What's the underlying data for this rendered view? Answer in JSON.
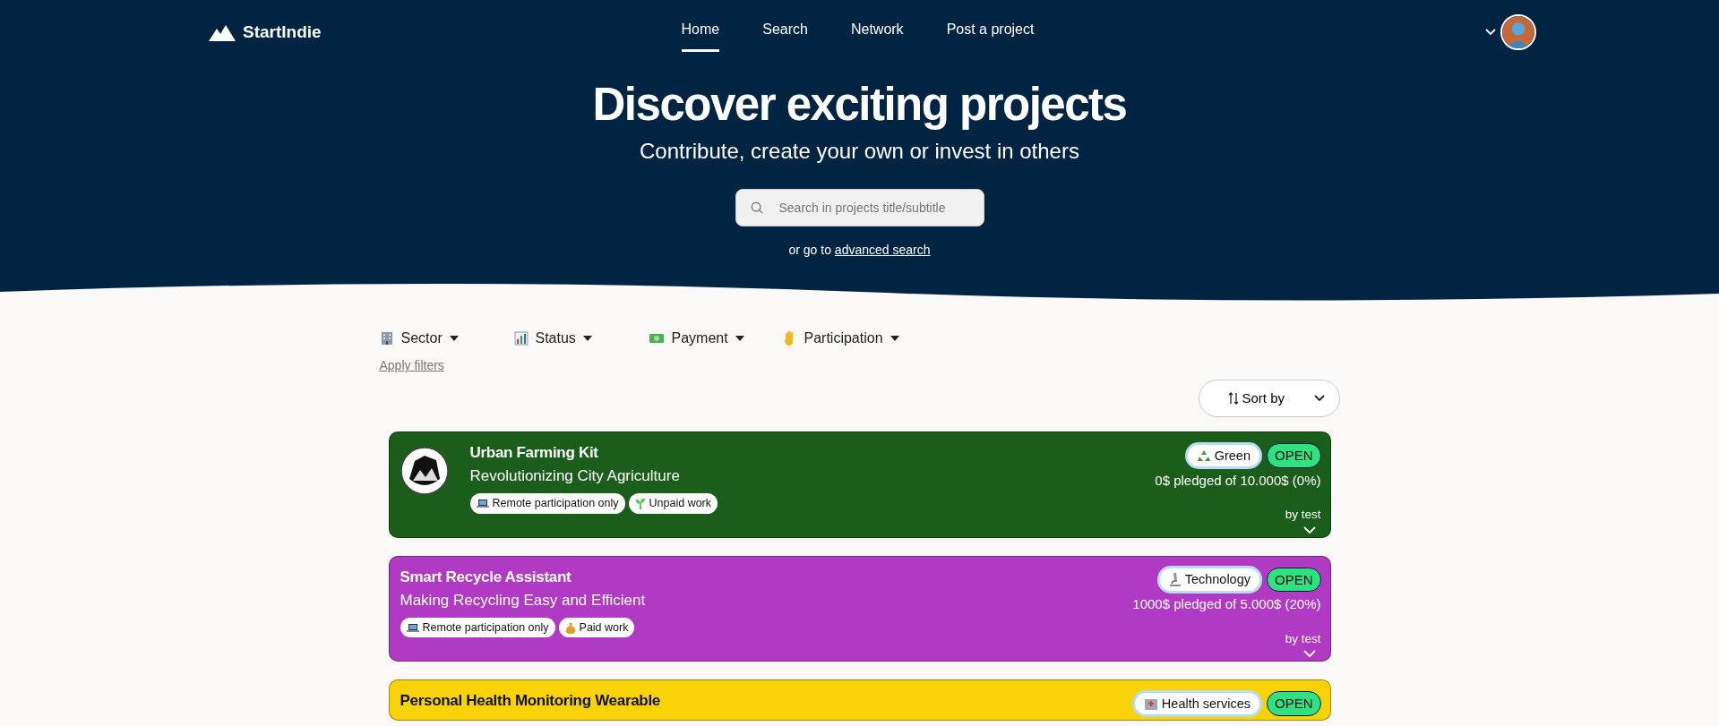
{
  "brand": {
    "name": "StartIndie"
  },
  "nav": [
    {
      "label": "Home",
      "selected": true
    },
    {
      "label": "Search",
      "selected": false
    },
    {
      "label": "Network",
      "selected": false
    },
    {
      "label": "Post a project",
      "selected": false
    }
  ],
  "hero": {
    "title": "Discover exciting projects",
    "subtitle": "Contribute, create your own or invest in others",
    "search": {
      "placeholder": "Search in projects title/subtitle"
    },
    "hint": "or go to",
    "hint_link": "advanced search"
  },
  "filters": [
    {
      "kind": "sector",
      "label": "Sector"
    },
    {
      "kind": "status",
      "label": "Status"
    },
    {
      "kind": "payment",
      "label": "Payment"
    },
    {
      "kind": "participation",
      "label": "Participation"
    }
  ],
  "apply_filters": "Apply filters",
  "sort": {
    "label": "Sort by"
  },
  "projects": [
    {
      "title": "Urban Farming Kit",
      "subtitle": "Revolutionizing City Agriculture",
      "color": "#1b5e1b",
      "logo": true,
      "tags": [
        {
          "kind": "remote",
          "label": "Remote participation only"
        },
        {
          "kind": "unpaid",
          "label": "Unpaid work"
        }
      ],
      "sector": {
        "kind": "green",
        "label": "Green"
      },
      "status": "OPEN",
      "pledged": "0$ pledged of 10.000$ (0%)",
      "author": "by test"
    },
    {
      "title": "Smart Recycle Assistant",
      "subtitle": "Making Recycling Easy and Efficient",
      "color": "#b03ac4",
      "logo": false,
      "tags": [
        {
          "kind": "remote",
          "label": "Remote participation only"
        },
        {
          "kind": "paid",
          "label": "Paid work"
        }
      ],
      "sector": {
        "kind": "technology",
        "label": "Technology"
      },
      "status": "OPEN",
      "pledged": "1000$ pledged of 5.000$ (20%)",
      "author": "by test"
    },
    {
      "title": "Personal Health Monitoring Wearable",
      "color": "#f8d30a",
      "logo": false,
      "sector": {
        "kind": "health",
        "label": "Health services"
      },
      "status": "OPEN"
    }
  ]
}
